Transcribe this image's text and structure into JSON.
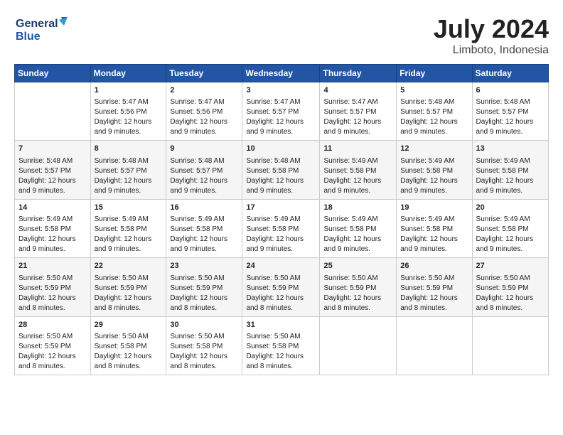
{
  "logo": {
    "text_general": "General",
    "text_blue": "Blue"
  },
  "title": "July 2024",
  "location": "Limboto, Indonesia",
  "days_of_week": [
    "Sunday",
    "Monday",
    "Tuesday",
    "Wednesday",
    "Thursday",
    "Friday",
    "Saturday"
  ],
  "weeks": [
    [
      {
        "day": "",
        "content": ""
      },
      {
        "day": "1",
        "content": "Sunrise: 5:47 AM\nSunset: 5:56 PM\nDaylight: 12 hours\nand 9 minutes."
      },
      {
        "day": "2",
        "content": "Sunrise: 5:47 AM\nSunset: 5:56 PM\nDaylight: 12 hours\nand 9 minutes."
      },
      {
        "day": "3",
        "content": "Sunrise: 5:47 AM\nSunset: 5:57 PM\nDaylight: 12 hours\nand 9 minutes."
      },
      {
        "day": "4",
        "content": "Sunrise: 5:47 AM\nSunset: 5:57 PM\nDaylight: 12 hours\nand 9 minutes."
      },
      {
        "day": "5",
        "content": "Sunrise: 5:48 AM\nSunset: 5:57 PM\nDaylight: 12 hours\nand 9 minutes."
      },
      {
        "day": "6",
        "content": "Sunrise: 5:48 AM\nSunset: 5:57 PM\nDaylight: 12 hours\nand 9 minutes."
      }
    ],
    [
      {
        "day": "7",
        "content": "Sunrise: 5:48 AM\nSunset: 5:57 PM\nDaylight: 12 hours\nand 9 minutes."
      },
      {
        "day": "8",
        "content": "Sunrise: 5:48 AM\nSunset: 5:57 PM\nDaylight: 12 hours\nand 9 minutes."
      },
      {
        "day": "9",
        "content": "Sunrise: 5:48 AM\nSunset: 5:57 PM\nDaylight: 12 hours\nand 9 minutes."
      },
      {
        "day": "10",
        "content": "Sunrise: 5:48 AM\nSunset: 5:58 PM\nDaylight: 12 hours\nand 9 minutes."
      },
      {
        "day": "11",
        "content": "Sunrise: 5:49 AM\nSunset: 5:58 PM\nDaylight: 12 hours\nand 9 minutes."
      },
      {
        "day": "12",
        "content": "Sunrise: 5:49 AM\nSunset: 5:58 PM\nDaylight: 12 hours\nand 9 minutes."
      },
      {
        "day": "13",
        "content": "Sunrise: 5:49 AM\nSunset: 5:58 PM\nDaylight: 12 hours\nand 9 minutes."
      }
    ],
    [
      {
        "day": "14",
        "content": "Sunrise: 5:49 AM\nSunset: 5:58 PM\nDaylight: 12 hours\nand 9 minutes."
      },
      {
        "day": "15",
        "content": "Sunrise: 5:49 AM\nSunset: 5:58 PM\nDaylight: 12 hours\nand 9 minutes."
      },
      {
        "day": "16",
        "content": "Sunrise: 5:49 AM\nSunset: 5:58 PM\nDaylight: 12 hours\nand 9 minutes."
      },
      {
        "day": "17",
        "content": "Sunrise: 5:49 AM\nSunset: 5:58 PM\nDaylight: 12 hours\nand 9 minutes."
      },
      {
        "day": "18",
        "content": "Sunrise: 5:49 AM\nSunset: 5:58 PM\nDaylight: 12 hours\nand 9 minutes."
      },
      {
        "day": "19",
        "content": "Sunrise: 5:49 AM\nSunset: 5:58 PM\nDaylight: 12 hours\nand 9 minutes."
      },
      {
        "day": "20",
        "content": "Sunrise: 5:49 AM\nSunset: 5:58 PM\nDaylight: 12 hours\nand 9 minutes."
      }
    ],
    [
      {
        "day": "21",
        "content": "Sunrise: 5:50 AM\nSunset: 5:59 PM\nDaylight: 12 hours\nand 8 minutes."
      },
      {
        "day": "22",
        "content": "Sunrise: 5:50 AM\nSunset: 5:59 PM\nDaylight: 12 hours\nand 8 minutes."
      },
      {
        "day": "23",
        "content": "Sunrise: 5:50 AM\nSunset: 5:59 PM\nDaylight: 12 hours\nand 8 minutes."
      },
      {
        "day": "24",
        "content": "Sunrise: 5:50 AM\nSunset: 5:59 PM\nDaylight: 12 hours\nand 8 minutes."
      },
      {
        "day": "25",
        "content": "Sunrise: 5:50 AM\nSunset: 5:59 PM\nDaylight: 12 hours\nand 8 minutes."
      },
      {
        "day": "26",
        "content": "Sunrise: 5:50 AM\nSunset: 5:59 PM\nDaylight: 12 hours\nand 8 minutes."
      },
      {
        "day": "27",
        "content": "Sunrise: 5:50 AM\nSunset: 5:59 PM\nDaylight: 12 hours\nand 8 minutes."
      }
    ],
    [
      {
        "day": "28",
        "content": "Sunrise: 5:50 AM\nSunset: 5:59 PM\nDaylight: 12 hours\nand 8 minutes."
      },
      {
        "day": "29",
        "content": "Sunrise: 5:50 AM\nSunset: 5:58 PM\nDaylight: 12 hours\nand 8 minutes."
      },
      {
        "day": "30",
        "content": "Sunrise: 5:50 AM\nSunset: 5:58 PM\nDaylight: 12 hours\nand 8 minutes."
      },
      {
        "day": "31",
        "content": "Sunrise: 5:50 AM\nSunset: 5:58 PM\nDaylight: 12 hours\nand 8 minutes."
      },
      {
        "day": "",
        "content": ""
      },
      {
        "day": "",
        "content": ""
      },
      {
        "day": "",
        "content": ""
      }
    ]
  ]
}
